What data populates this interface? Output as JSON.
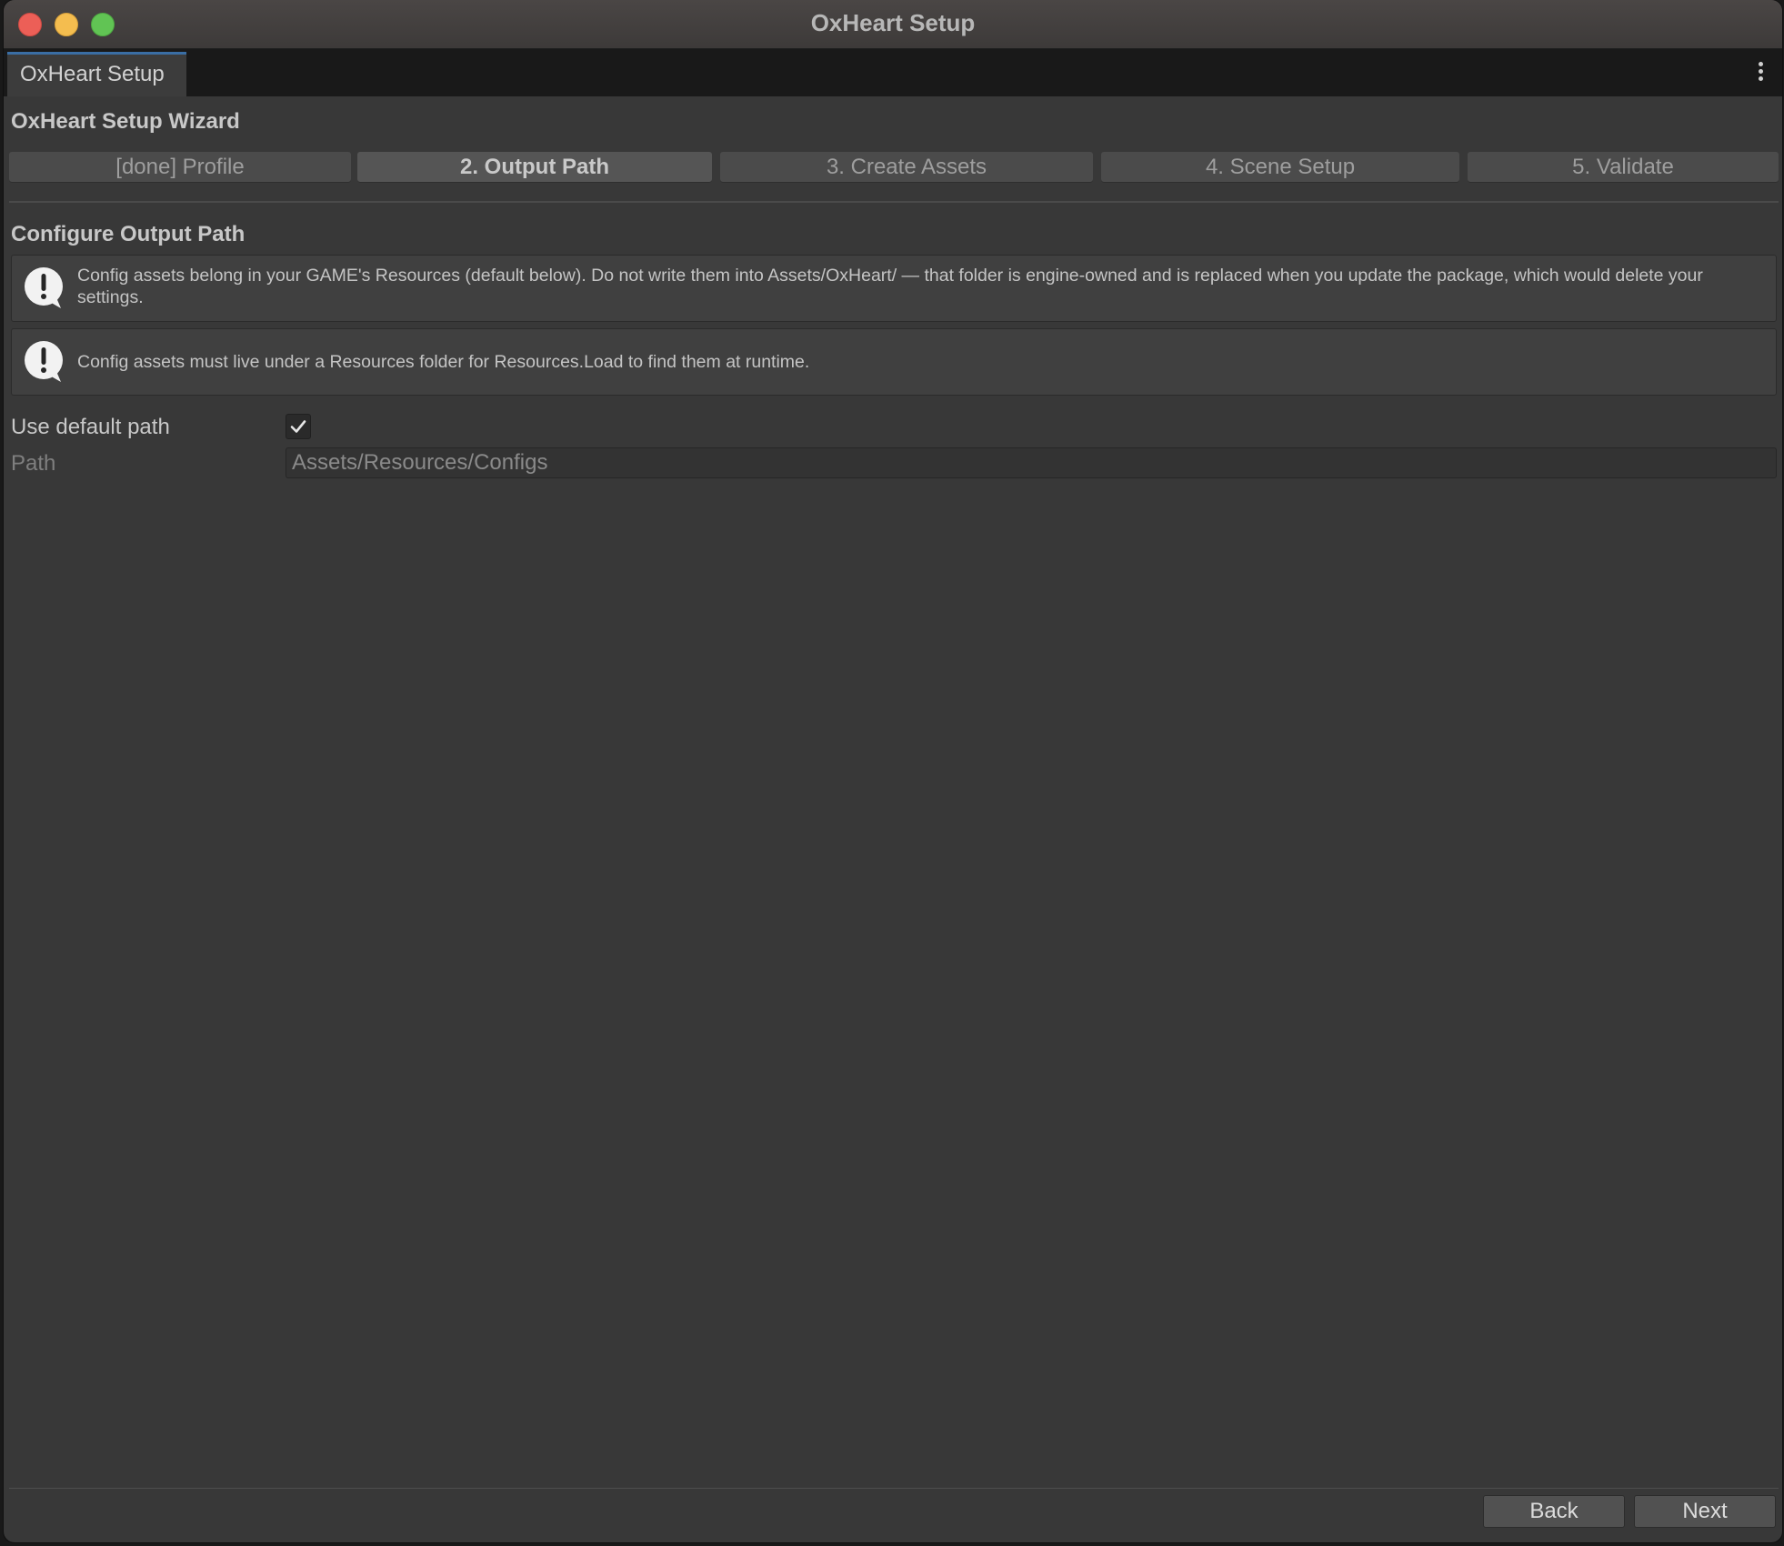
{
  "window": {
    "title": "OxHeart Setup"
  },
  "tab": {
    "label": "OxHeart Setup"
  },
  "wizard": {
    "title": "OxHeart Setup Wizard",
    "steps": [
      {
        "label": "[done] Profile",
        "active": false
      },
      {
        "label": "2. Output Path",
        "active": true
      },
      {
        "label": "3. Create Assets",
        "active": false
      },
      {
        "label": "4. Scene Setup",
        "active": false
      },
      {
        "label": "5. Validate",
        "active": false
      }
    ]
  },
  "section": {
    "title": "Configure Output Path",
    "warnings": [
      "Config assets belong in your GAME's Resources (default below). Do not write them into Assets/OxHeart/ — that folder is engine-owned and is replaced when you update the package, which would delete your settings.",
      "Config assets must live under a Resources folder for Resources.Load to find them at runtime."
    ]
  },
  "fields": {
    "use_default_label": "Use default path",
    "use_default_checked": true,
    "path_label": "Path",
    "path_value": "Assets/Resources/Configs"
  },
  "footer": {
    "back_label": "Back",
    "next_label": "Next"
  },
  "colors": {
    "background": "#383838",
    "accent_tab": "#3a6ea5",
    "close": "#ec5f57",
    "minimize": "#f4bd4f",
    "maximize": "#61c454"
  }
}
